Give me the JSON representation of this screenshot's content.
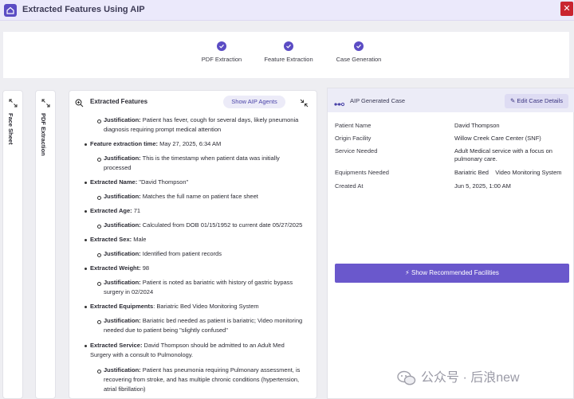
{
  "window": {
    "title": "Extracted Features Using AIP",
    "close_glyph": "✕"
  },
  "stepper": {
    "steps": [
      {
        "label": "PDF Extraction"
      },
      {
        "label": "Feature Extraction"
      },
      {
        "label": "Case Generation"
      }
    ]
  },
  "side_tabs": {
    "face_sheet": "Face Sheet",
    "pdf_extraction": "PDF Extraction"
  },
  "features": {
    "title": "Extracted Features",
    "agents_button": "Show AIP Agents",
    "items": [
      {
        "kind": "sub",
        "bold": "",
        "text": "Patient has fever, cough for several days, likely pneumonia diagnosis requiring prompt medical attention",
        "prefix": "Justification:"
      },
      {
        "kind": "main",
        "bold": "Feature extraction time:",
        "text": " May 27, 2025, 6:34 AM"
      },
      {
        "kind": "sub",
        "prefix": "Justification:",
        "text": "This is the timestamp when patient data was initially processed"
      },
      {
        "kind": "main",
        "bold": "Extracted Name:",
        "text": " \"David Thompson\""
      },
      {
        "kind": "sub",
        "prefix": "Justification:",
        "text": "Matches the full name on patient face sheet"
      },
      {
        "kind": "main",
        "bold": "Extracted Age:",
        "text": " 71"
      },
      {
        "kind": "sub",
        "prefix": "Justification:",
        "text": "Calculated from DOB 01/15/1952 to current date 05/27/2025"
      },
      {
        "kind": "main",
        "bold": "Extracted Sex:",
        "text": " Male"
      },
      {
        "kind": "sub",
        "prefix": "Justification:",
        "text": "Identified from patient records"
      },
      {
        "kind": "main",
        "bold": "Extracted Weight:",
        "text": " 98"
      },
      {
        "kind": "sub",
        "prefix": "Justification:",
        "text": "Patient is noted as bariatric with history of gastric bypass surgery in 02/2024"
      },
      {
        "kind": "main",
        "bold": "Extracted Equipments",
        "text": ": Bariatric Bed Video Monitoring System"
      },
      {
        "kind": "sub",
        "prefix": "Justification:",
        "text": "Bariatric bed needed as patient is bariatric; Video monitoring needed due to patient being \"slightly confused\""
      },
      {
        "kind": "main",
        "bold": "Extracted Service:",
        "text": " David Thompson should be admitted to an Adult Med Surgery with a consult to Pulmonology."
      },
      {
        "kind": "sub",
        "prefix": "Justification:",
        "text": "Patient has pneumonia requiring Pulmonary assessment, is recovering from stroke, and has multiple chronic conditions (hypertension, atrial fibrillation)"
      }
    ]
  },
  "case": {
    "title": "AIP Generated Case",
    "edit_button": "Edit Case Details",
    "rows": [
      {
        "label": "Patient Name",
        "value": "David Thompson"
      },
      {
        "label": "Origin Facility",
        "value": "Willow Creek Care Center (SNF)"
      },
      {
        "label": "Service Needed",
        "value": "Adult Medical service with a focus on pulmonary care."
      },
      {
        "label": "Equipments Needed",
        "value": "Bariatric Bed    Video Monitoring System"
      },
      {
        "label": "Created At",
        "value": "Jun 5, 2025, 1:00 AM"
      }
    ],
    "recommend_button": "Show Recommended Facilities"
  },
  "watermark": {
    "text": "公众号 · 后浪new"
  },
  "colors": {
    "accent": "#5b4cc4",
    "button": "#6a58cc",
    "close": "#c9242f"
  }
}
